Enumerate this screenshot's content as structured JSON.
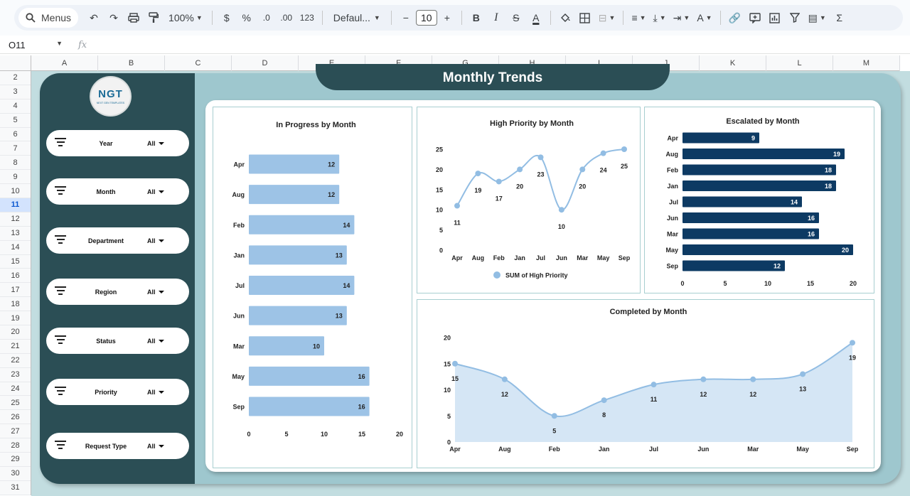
{
  "toolbar": {
    "menus_label": "Menus",
    "zoom": "100%",
    "currency": "$",
    "percent": "%",
    "dec_decrease": ".0",
    "dec_increase": ".00",
    "number_format": "123",
    "font": "Defaul...",
    "font_size": "10",
    "minus": "−",
    "plus": "+",
    "bold": "B",
    "italic": "I",
    "strike": "S",
    "text_color": "A",
    "sum": "Σ"
  },
  "formula_bar": {
    "cell_ref": "O11",
    "fx": "fx"
  },
  "columns": [
    "A",
    "B",
    "C",
    "D",
    "E",
    "F",
    "G",
    "H",
    "I",
    "J",
    "K",
    "L",
    "M"
  ],
  "rows": [
    "2",
    "3",
    "4",
    "5",
    "6",
    "7",
    "8",
    "9",
    "10",
    "11",
    "12",
    "13",
    "14",
    "15",
    "16",
    "17",
    "18",
    "19",
    "20",
    "21",
    "22",
    "23",
    "24",
    "25",
    "26",
    "27",
    "28",
    "29",
    "30",
    "31"
  ],
  "active_row": "11",
  "logo": {
    "text": "NGT",
    "subtext": "NEXT GEN TEMPLATES"
  },
  "dashboard_title": "Monthly Trends",
  "filters": [
    {
      "label": "Year",
      "value": "All"
    },
    {
      "label": "Month",
      "value": "All"
    },
    {
      "label": "Department",
      "value": "All"
    },
    {
      "label": "Region",
      "value": "All"
    },
    {
      "label": "Status",
      "value": "All"
    },
    {
      "label": "Priority",
      "value": "All"
    },
    {
      "label": "Request Type",
      "value": "All"
    }
  ],
  "colors": {
    "sidebar": "#2b4e55",
    "frame": "#9ec7ce",
    "light_bar": "#9dc3e6",
    "dark_bar": "#0d3a63",
    "line": "#92bde3",
    "area": "#d5e6f5"
  },
  "chart_data": [
    {
      "type": "bar",
      "orientation": "horizontal",
      "title": "In Progress by Month",
      "categories": [
        "Apr",
        "Aug",
        "Feb",
        "Jan",
        "Jul",
        "Jun",
        "Mar",
        "May",
        "Sep"
      ],
      "values": [
        12,
        12,
        14,
        13,
        14,
        13,
        10,
        16,
        16
      ],
      "xlim": [
        0,
        20
      ],
      "xticks": [
        0,
        5,
        10,
        15,
        20
      ],
      "color": "#9dc3e6"
    },
    {
      "type": "line",
      "title": "High Priority by Month",
      "categories": [
        "Apr",
        "Aug",
        "Feb",
        "Jan",
        "Jul",
        "Jun",
        "Mar",
        "May",
        "Sep"
      ],
      "series": [
        {
          "name": "SUM of High Priority",
          "values": [
            11,
            19,
            17,
            20,
            23,
            10,
            20,
            24,
            25
          ]
        }
      ],
      "ylim": [
        0,
        25
      ],
      "yticks": [
        0,
        5,
        10,
        15,
        20,
        25
      ],
      "legend": "bottom",
      "color": "#92bde3"
    },
    {
      "type": "bar",
      "orientation": "horizontal",
      "title": "Escalated by Month",
      "categories": [
        "Apr",
        "Aug",
        "Feb",
        "Jan",
        "Jul",
        "Jun",
        "Mar",
        "May",
        "Sep"
      ],
      "values": [
        9,
        19,
        18,
        18,
        14,
        16,
        16,
        20,
        12
      ],
      "xlim": [
        0,
        20
      ],
      "xticks": [
        0,
        5,
        10,
        15,
        20
      ],
      "color": "#0d3a63"
    },
    {
      "type": "area",
      "title": "Completed by Month",
      "categories": [
        "Apr",
        "Aug",
        "Feb",
        "Jan",
        "Jul",
        "Jun",
        "Mar",
        "May",
        "Sep"
      ],
      "values": [
        15,
        12,
        5,
        8,
        11,
        12,
        12,
        13,
        19
      ],
      "ylim": [
        0,
        20
      ],
      "yticks": [
        0,
        5,
        10,
        15,
        20
      ],
      "color": "#92bde3"
    }
  ]
}
